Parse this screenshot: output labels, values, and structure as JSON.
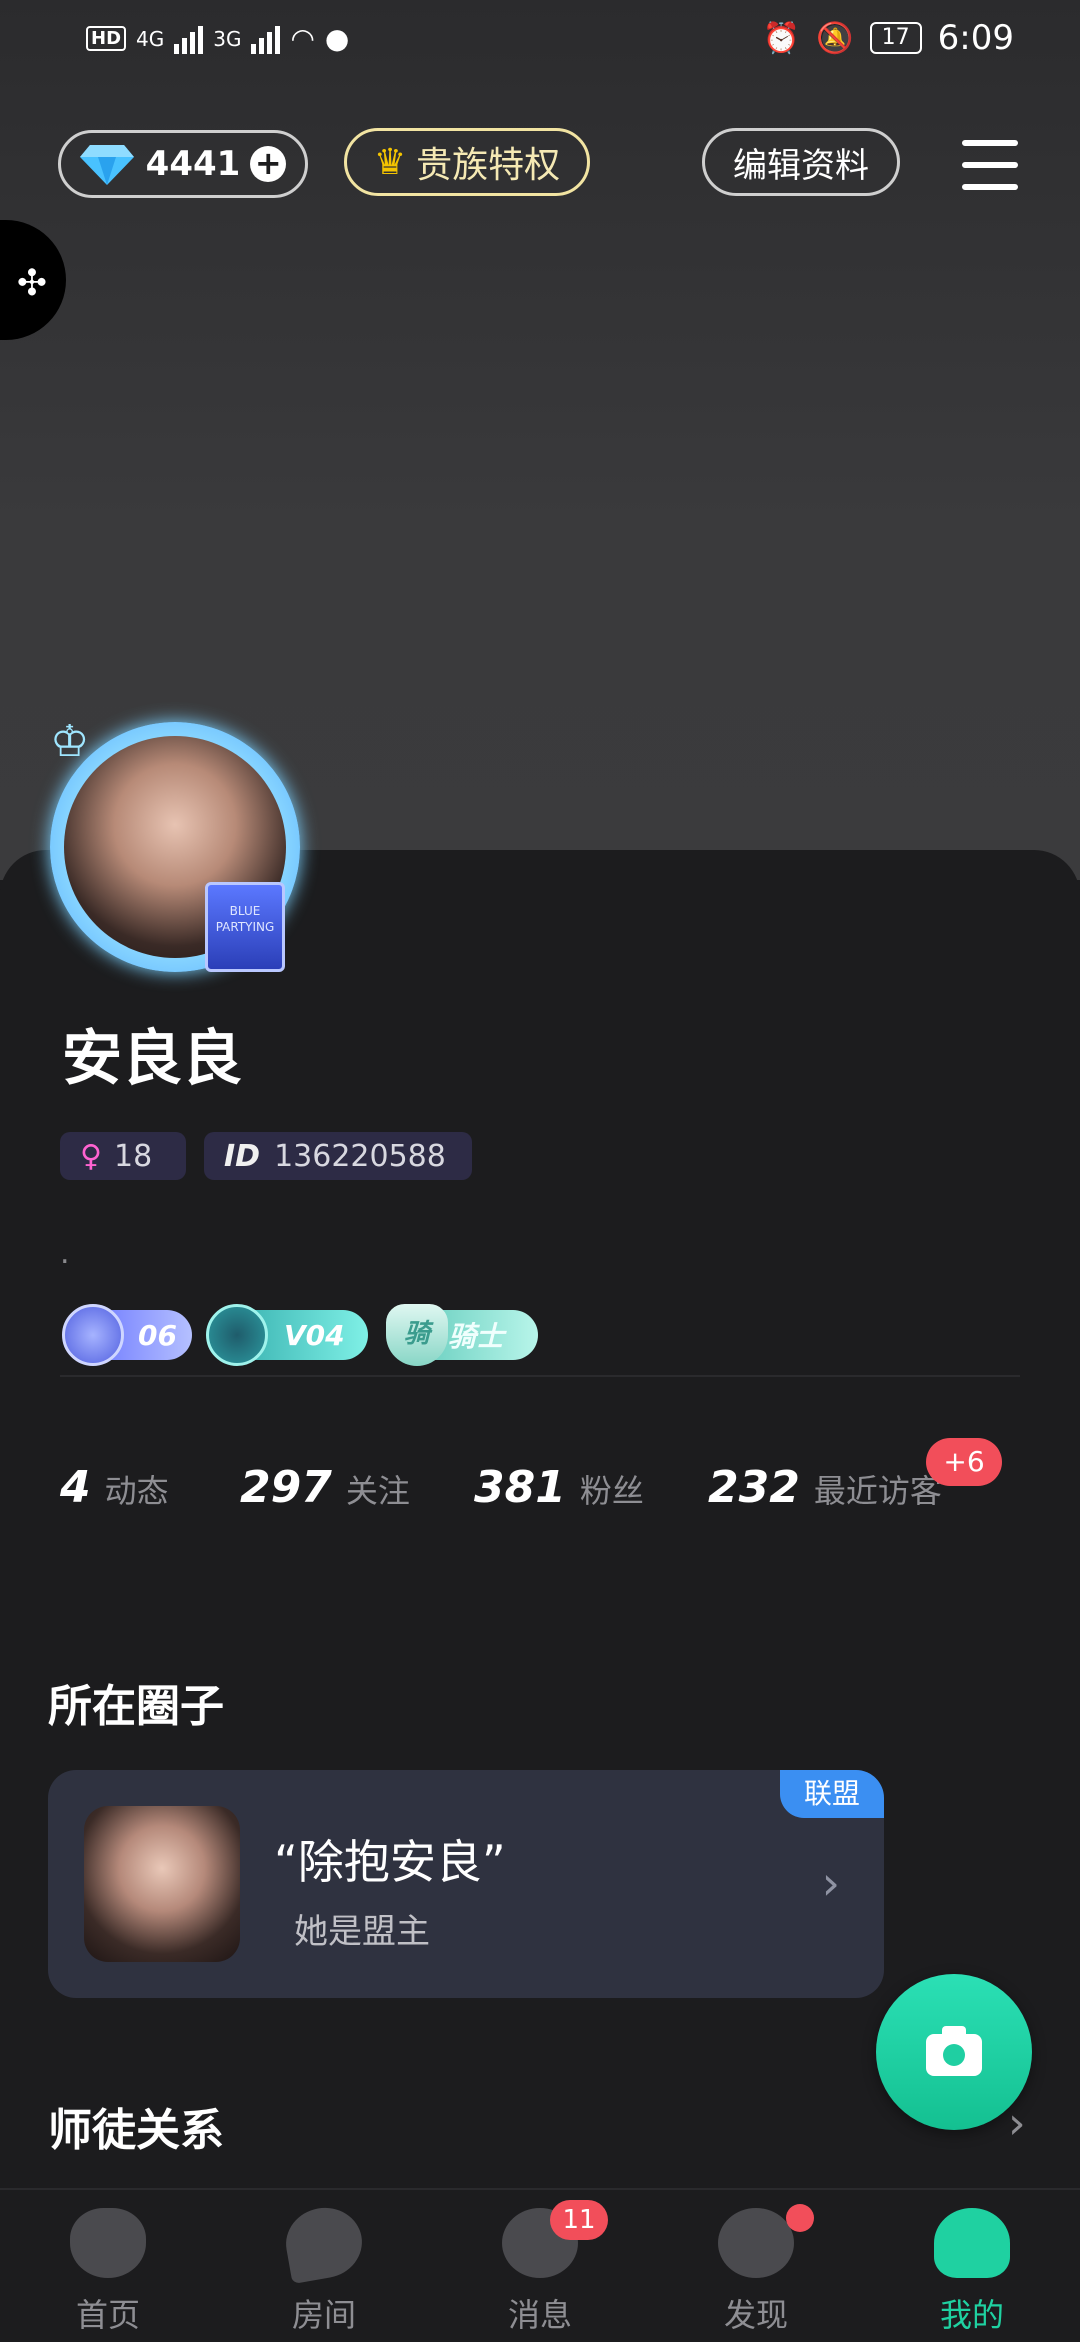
{
  "status_bar": {
    "left_hd": "HD",
    "net1": "4G",
    "net2": "3G",
    "battery": "17",
    "time": "6:09"
  },
  "header": {
    "diamonds": "4441",
    "noble_label": "贵族特权",
    "edit_label": "编辑资料"
  },
  "profile": {
    "name": "安良良",
    "age": "18",
    "id_label": "ID",
    "id_value": "136220588",
    "bio": ".",
    "perfume_text": "BLUE PARTYING",
    "badges": [
      {
        "text": "06"
      },
      {
        "text": "V04"
      },
      {
        "text": "骑士",
        "icon_text": "骑"
      }
    ]
  },
  "stats": [
    {
      "num": "4",
      "label": "动态"
    },
    {
      "num": "297",
      "label": "关注"
    },
    {
      "num": "381",
      "label": "粉丝"
    },
    {
      "num": "232",
      "label": "最近访客"
    }
  ],
  "visitors_badge": "+6",
  "circle_section": {
    "title": "所在圈子",
    "card_name": "“除抱安良”",
    "card_sub": "她是盟主",
    "tag": "联盟"
  },
  "mentor_section": {
    "title": "师徒关系"
  },
  "tabs": [
    {
      "label": "首页"
    },
    {
      "label": "房间"
    },
    {
      "label": "消息",
      "badge": "11"
    },
    {
      "label": "发现"
    },
    {
      "label": "我的"
    }
  ],
  "colors": {
    "accent": "#1fd1a1",
    "badge_red": "#f24e5a",
    "noble_gold": "#f2e4a2"
  }
}
